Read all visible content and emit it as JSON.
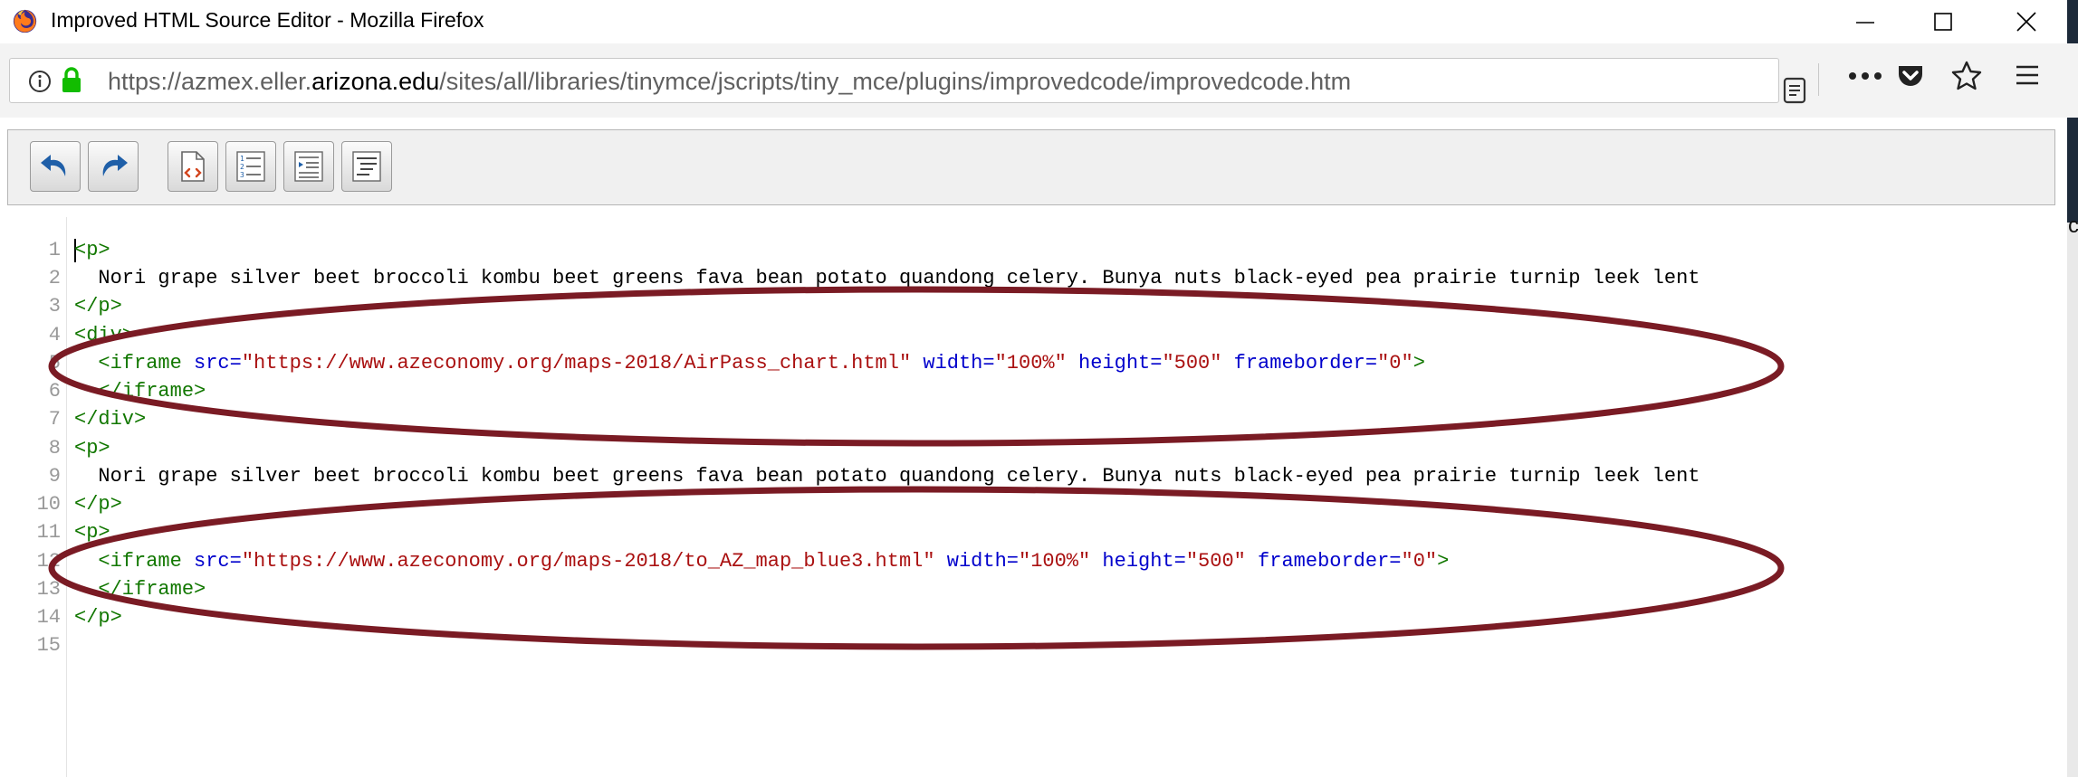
{
  "window": {
    "title": "Improved HTML Source Editor - Mozilla Firefox",
    "icons": [
      "firefox-logo",
      "minimize-icon",
      "maximize-icon",
      "close-icon"
    ]
  },
  "address_bar": {
    "url_prefix": "https://azmex.eller.",
    "url_domain": "arizona.edu",
    "url_path": "/sites/all/libraries/tinymce/jscripts/tiny_mce/plugins/improvedcode/improvedcode.htm",
    "icons": [
      "info-icon",
      "lock-icon",
      "reader-view-icon",
      "more-icon",
      "pocket-icon",
      "bookmark-star-icon",
      "hamburger-menu-icon"
    ]
  },
  "toolbar": {
    "buttons": [
      "undo",
      "redo",
      "toggle-word-wrap",
      "toggle-line-numbers",
      "auto-indent",
      "format-code"
    ]
  },
  "edge_char": "c",
  "editor": {
    "line_numbers": [
      "1",
      "2",
      "3",
      "4",
      "5",
      "6",
      "7",
      "8",
      "9",
      "10",
      "11",
      "12",
      "13",
      "14",
      "15"
    ],
    "lines": {
      "l1": {
        "tag": "<p>"
      },
      "l2": {
        "text": "  Nori grape silver beet broccoli kombu beet greens fava bean potato quandong celery. Bunya nuts black-eyed pea prairie turnip leek lent"
      },
      "l3": {
        "tag": "</p>"
      },
      "l4": {
        "tag": "<div>"
      },
      "l5": {
        "indent": "  ",
        "open": "<iframe",
        "a1": " src=",
        "v1": "\"https://www.azeconomy.org/maps-2018/AirPass_chart.html\"",
        "a2": " width=",
        "v2": "\"100%\"",
        "a3": " height=",
        "v3": "\"500\"",
        "a4": " frameborder=",
        "v4": "\"0\"",
        "close": ">"
      },
      "l6": {
        "tag": "  </iframe>"
      },
      "l7": {
        "tag": "</div>"
      },
      "l8": {
        "tag": "<p>"
      },
      "l9": {
        "text": "  Nori grape silver beet broccoli kombu beet greens fava bean potato quandong celery. Bunya nuts black-eyed pea prairie turnip leek lent"
      },
      "l10": {
        "tag": "</p>"
      },
      "l11": {
        "tag": "<p>"
      },
      "l12": {
        "indent": "  ",
        "open": "<iframe",
        "a1": " src=",
        "v1": "\"https://www.azeconomy.org/maps-2018/to_AZ_map_blue3.html\"",
        "a2": " width=",
        "v2": "\"100%\"",
        "a3": " height=",
        "v3": "\"500\"",
        "a4": " frameborder=",
        "v4": "\"0\"",
        "close": ">"
      },
      "l13": {
        "tag": "  </iframe>"
      },
      "l14": {
        "tag": "</p>"
      }
    }
  },
  "annotation": {
    "color": "#7a1b24"
  },
  "colors": {
    "tag": "#117700",
    "attribute": "#0000cc",
    "string": "#aa1111",
    "line_number": "#999999"
  }
}
